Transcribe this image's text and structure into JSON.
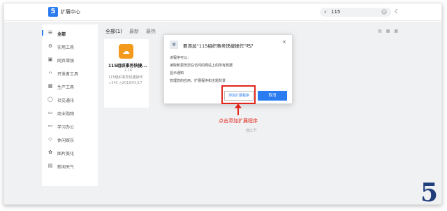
{
  "app": {
    "logo_text": "5",
    "title": "扩展中心"
  },
  "search": {
    "value": "115",
    "clear_label": "×"
  },
  "sidebar": {
    "items": [
      {
        "label": "全部",
        "icon": "☰"
      },
      {
        "label": "实用工具",
        "icon": "⚙"
      },
      {
        "label": "网页增强",
        "icon": "▣"
      },
      {
        "label": "开发者工具",
        "icon": "‹›"
      },
      {
        "label": "生产工具",
        "icon": "▦"
      },
      {
        "label": "社交通讯",
        "icon": "◯"
      },
      {
        "label": "商业购物",
        "icon": "▭"
      },
      {
        "label": "学习办公",
        "icon": "▭"
      },
      {
        "label": "休闲娱乐",
        "icon": "◇"
      },
      {
        "label": "图片美化",
        "icon": "✿"
      },
      {
        "label": "新闻天气",
        "icon": "▤"
      }
    ]
  },
  "tabs": [
    {
      "label": "全部(1)"
    },
    {
      "label": "最新"
    },
    {
      "label": "最热"
    }
  ],
  "extension": {
    "name": "115组织事务快捷...",
    "version": "1.16",
    "description": "115组织事务快捷操作",
    "stats": "↓345  ◷2018/05/17"
  },
  "result_count": "共1个",
  "dialog": {
    "title": "要添加“115组织事务快捷操作”吗？",
    "close_label": "×",
    "lines": [
      "该程序可以：",
      "读取和更改您在访问的网站上的所有数据",
      "显示通知",
      "管理您的应用、扩展程序和主题背景"
    ],
    "add_button": "添加扩展程序",
    "cancel_button": "取消"
  },
  "annotation": "点击添加扩展程序",
  "watermark": "5",
  "colors": {
    "accent": "#2b7cf0",
    "annotation": "#e3261b",
    "ext_logo": "#f39a1d"
  }
}
